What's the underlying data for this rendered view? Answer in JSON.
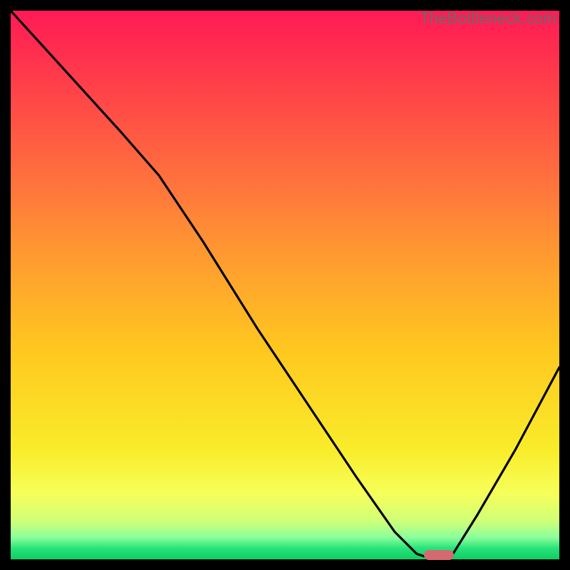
{
  "watermark": "TheBottleneck.com",
  "chart_data": {
    "type": "line",
    "title": "",
    "xlabel": "",
    "ylabel": "",
    "xlim": [
      0,
      100
    ],
    "ylim": [
      0,
      100
    ],
    "grid": false,
    "series": [
      {
        "name": "curve",
        "x": [
          0,
          10,
          20,
          27,
          35,
          45,
          55,
          63,
          70,
          74,
          77,
          80,
          85,
          92,
          100
        ],
        "y": [
          100,
          89,
          78,
          70,
          58,
          42,
          27,
          15,
          5,
          1,
          0,
          0,
          8,
          20,
          35
        ]
      }
    ],
    "marker": {
      "x": 78,
      "y": 0.8
    },
    "colors": {
      "curve": "#000000",
      "marker": "#d46a6f",
      "gradient_top": "#ff1a56",
      "gradient_bottom": "#0dcf63"
    }
  }
}
